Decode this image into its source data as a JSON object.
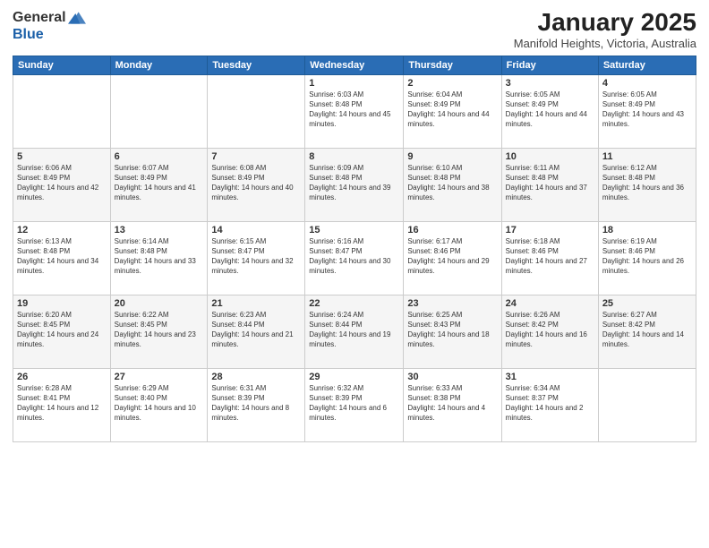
{
  "logo": {
    "general": "General",
    "blue": "Blue"
  },
  "title": {
    "month": "January 2025",
    "location": "Manifold Heights, Victoria, Australia"
  },
  "weekdays": [
    "Sunday",
    "Monday",
    "Tuesday",
    "Wednesday",
    "Thursday",
    "Friday",
    "Saturday"
  ],
  "weeks": [
    [
      {
        "day": "",
        "sunrise": "",
        "sunset": "",
        "daylight": ""
      },
      {
        "day": "",
        "sunrise": "",
        "sunset": "",
        "daylight": ""
      },
      {
        "day": "",
        "sunrise": "",
        "sunset": "",
        "daylight": ""
      },
      {
        "day": "1",
        "sunrise": "Sunrise: 6:03 AM",
        "sunset": "Sunset: 8:48 PM",
        "daylight": "Daylight: 14 hours and 45 minutes."
      },
      {
        "day": "2",
        "sunrise": "Sunrise: 6:04 AM",
        "sunset": "Sunset: 8:49 PM",
        "daylight": "Daylight: 14 hours and 44 minutes."
      },
      {
        "day": "3",
        "sunrise": "Sunrise: 6:05 AM",
        "sunset": "Sunset: 8:49 PM",
        "daylight": "Daylight: 14 hours and 44 minutes."
      },
      {
        "day": "4",
        "sunrise": "Sunrise: 6:05 AM",
        "sunset": "Sunset: 8:49 PM",
        "daylight": "Daylight: 14 hours and 43 minutes."
      }
    ],
    [
      {
        "day": "5",
        "sunrise": "Sunrise: 6:06 AM",
        "sunset": "Sunset: 8:49 PM",
        "daylight": "Daylight: 14 hours and 42 minutes."
      },
      {
        "day": "6",
        "sunrise": "Sunrise: 6:07 AM",
        "sunset": "Sunset: 8:49 PM",
        "daylight": "Daylight: 14 hours and 41 minutes."
      },
      {
        "day": "7",
        "sunrise": "Sunrise: 6:08 AM",
        "sunset": "Sunset: 8:49 PM",
        "daylight": "Daylight: 14 hours and 40 minutes."
      },
      {
        "day": "8",
        "sunrise": "Sunrise: 6:09 AM",
        "sunset": "Sunset: 8:48 PM",
        "daylight": "Daylight: 14 hours and 39 minutes."
      },
      {
        "day": "9",
        "sunrise": "Sunrise: 6:10 AM",
        "sunset": "Sunset: 8:48 PM",
        "daylight": "Daylight: 14 hours and 38 minutes."
      },
      {
        "day": "10",
        "sunrise": "Sunrise: 6:11 AM",
        "sunset": "Sunset: 8:48 PM",
        "daylight": "Daylight: 14 hours and 37 minutes."
      },
      {
        "day": "11",
        "sunrise": "Sunrise: 6:12 AM",
        "sunset": "Sunset: 8:48 PM",
        "daylight": "Daylight: 14 hours and 36 minutes."
      }
    ],
    [
      {
        "day": "12",
        "sunrise": "Sunrise: 6:13 AM",
        "sunset": "Sunset: 8:48 PM",
        "daylight": "Daylight: 14 hours and 34 minutes."
      },
      {
        "day": "13",
        "sunrise": "Sunrise: 6:14 AM",
        "sunset": "Sunset: 8:48 PM",
        "daylight": "Daylight: 14 hours and 33 minutes."
      },
      {
        "day": "14",
        "sunrise": "Sunrise: 6:15 AM",
        "sunset": "Sunset: 8:47 PM",
        "daylight": "Daylight: 14 hours and 32 minutes."
      },
      {
        "day": "15",
        "sunrise": "Sunrise: 6:16 AM",
        "sunset": "Sunset: 8:47 PM",
        "daylight": "Daylight: 14 hours and 30 minutes."
      },
      {
        "day": "16",
        "sunrise": "Sunrise: 6:17 AM",
        "sunset": "Sunset: 8:46 PM",
        "daylight": "Daylight: 14 hours and 29 minutes."
      },
      {
        "day": "17",
        "sunrise": "Sunrise: 6:18 AM",
        "sunset": "Sunset: 8:46 PM",
        "daylight": "Daylight: 14 hours and 27 minutes."
      },
      {
        "day": "18",
        "sunrise": "Sunrise: 6:19 AM",
        "sunset": "Sunset: 8:46 PM",
        "daylight": "Daylight: 14 hours and 26 minutes."
      }
    ],
    [
      {
        "day": "19",
        "sunrise": "Sunrise: 6:20 AM",
        "sunset": "Sunset: 8:45 PM",
        "daylight": "Daylight: 14 hours and 24 minutes."
      },
      {
        "day": "20",
        "sunrise": "Sunrise: 6:22 AM",
        "sunset": "Sunset: 8:45 PM",
        "daylight": "Daylight: 14 hours and 23 minutes."
      },
      {
        "day": "21",
        "sunrise": "Sunrise: 6:23 AM",
        "sunset": "Sunset: 8:44 PM",
        "daylight": "Daylight: 14 hours and 21 minutes."
      },
      {
        "day": "22",
        "sunrise": "Sunrise: 6:24 AM",
        "sunset": "Sunset: 8:44 PM",
        "daylight": "Daylight: 14 hours and 19 minutes."
      },
      {
        "day": "23",
        "sunrise": "Sunrise: 6:25 AM",
        "sunset": "Sunset: 8:43 PM",
        "daylight": "Daylight: 14 hours and 18 minutes."
      },
      {
        "day": "24",
        "sunrise": "Sunrise: 6:26 AM",
        "sunset": "Sunset: 8:42 PM",
        "daylight": "Daylight: 14 hours and 16 minutes."
      },
      {
        "day": "25",
        "sunrise": "Sunrise: 6:27 AM",
        "sunset": "Sunset: 8:42 PM",
        "daylight": "Daylight: 14 hours and 14 minutes."
      }
    ],
    [
      {
        "day": "26",
        "sunrise": "Sunrise: 6:28 AM",
        "sunset": "Sunset: 8:41 PM",
        "daylight": "Daylight: 14 hours and 12 minutes."
      },
      {
        "day": "27",
        "sunrise": "Sunrise: 6:29 AM",
        "sunset": "Sunset: 8:40 PM",
        "daylight": "Daylight: 14 hours and 10 minutes."
      },
      {
        "day": "28",
        "sunrise": "Sunrise: 6:31 AM",
        "sunset": "Sunset: 8:39 PM",
        "daylight": "Daylight: 14 hours and 8 minutes."
      },
      {
        "day": "29",
        "sunrise": "Sunrise: 6:32 AM",
        "sunset": "Sunset: 8:39 PM",
        "daylight": "Daylight: 14 hours and 6 minutes."
      },
      {
        "day": "30",
        "sunrise": "Sunrise: 6:33 AM",
        "sunset": "Sunset: 8:38 PM",
        "daylight": "Daylight: 14 hours and 4 minutes."
      },
      {
        "day": "31",
        "sunrise": "Sunrise: 6:34 AM",
        "sunset": "Sunset: 8:37 PM",
        "daylight": "Daylight: 14 hours and 2 minutes."
      },
      {
        "day": "",
        "sunrise": "",
        "sunset": "",
        "daylight": ""
      }
    ]
  ]
}
